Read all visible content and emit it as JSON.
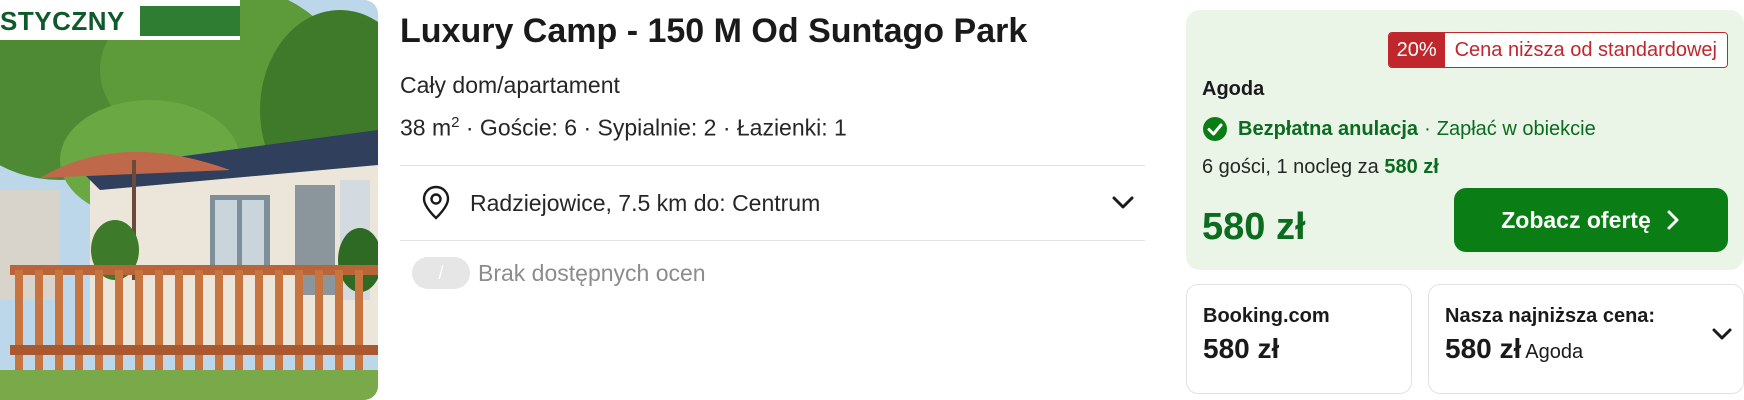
{
  "photo": {
    "badge_text": "STYCZNY"
  },
  "listing": {
    "title": "Luxury Camp - 150 M Od Suntago Park",
    "subtitle": "Cały dom/apartament",
    "specs_area": "38 m",
    "specs_area_sup": "2",
    "specs_rest": " · Goście: 6 · Sypialnie: 2 · Łazienki: 1",
    "location": "Radziejowice, 7.5 km do: Centrum",
    "rating_pill": "/",
    "rating_text": "Brak dostępnych ocen"
  },
  "deal": {
    "discount_pct": "20%",
    "discount_label": "Cena niższa od standardowej",
    "provider": "Agoda",
    "cancel_label": "Bezpłatna anulacja",
    "pay_sep": "·",
    "pay_label": "Zapłać w obiekcie",
    "guests_text": "6 gości, 1 nocleg za ",
    "guests_price": "580 zł",
    "price": "580 zł",
    "cta_label": "Zobacz ofertę"
  },
  "alt_offers": {
    "booking_label": "Booking.com",
    "booking_price": "580 zł",
    "lowest_label": "Nasza najniższa cena:",
    "lowest_price": "580 zł",
    "lowest_provider": "Agoda"
  },
  "colors": {
    "brand_green": "#0b7d15",
    "deal_bg": "#eaf5e7",
    "discount_red": "#c0272d"
  },
  "icons": [
    "map-pin-icon",
    "chevron-down-icon",
    "check-circle-icon",
    "chevron-right-icon"
  ]
}
